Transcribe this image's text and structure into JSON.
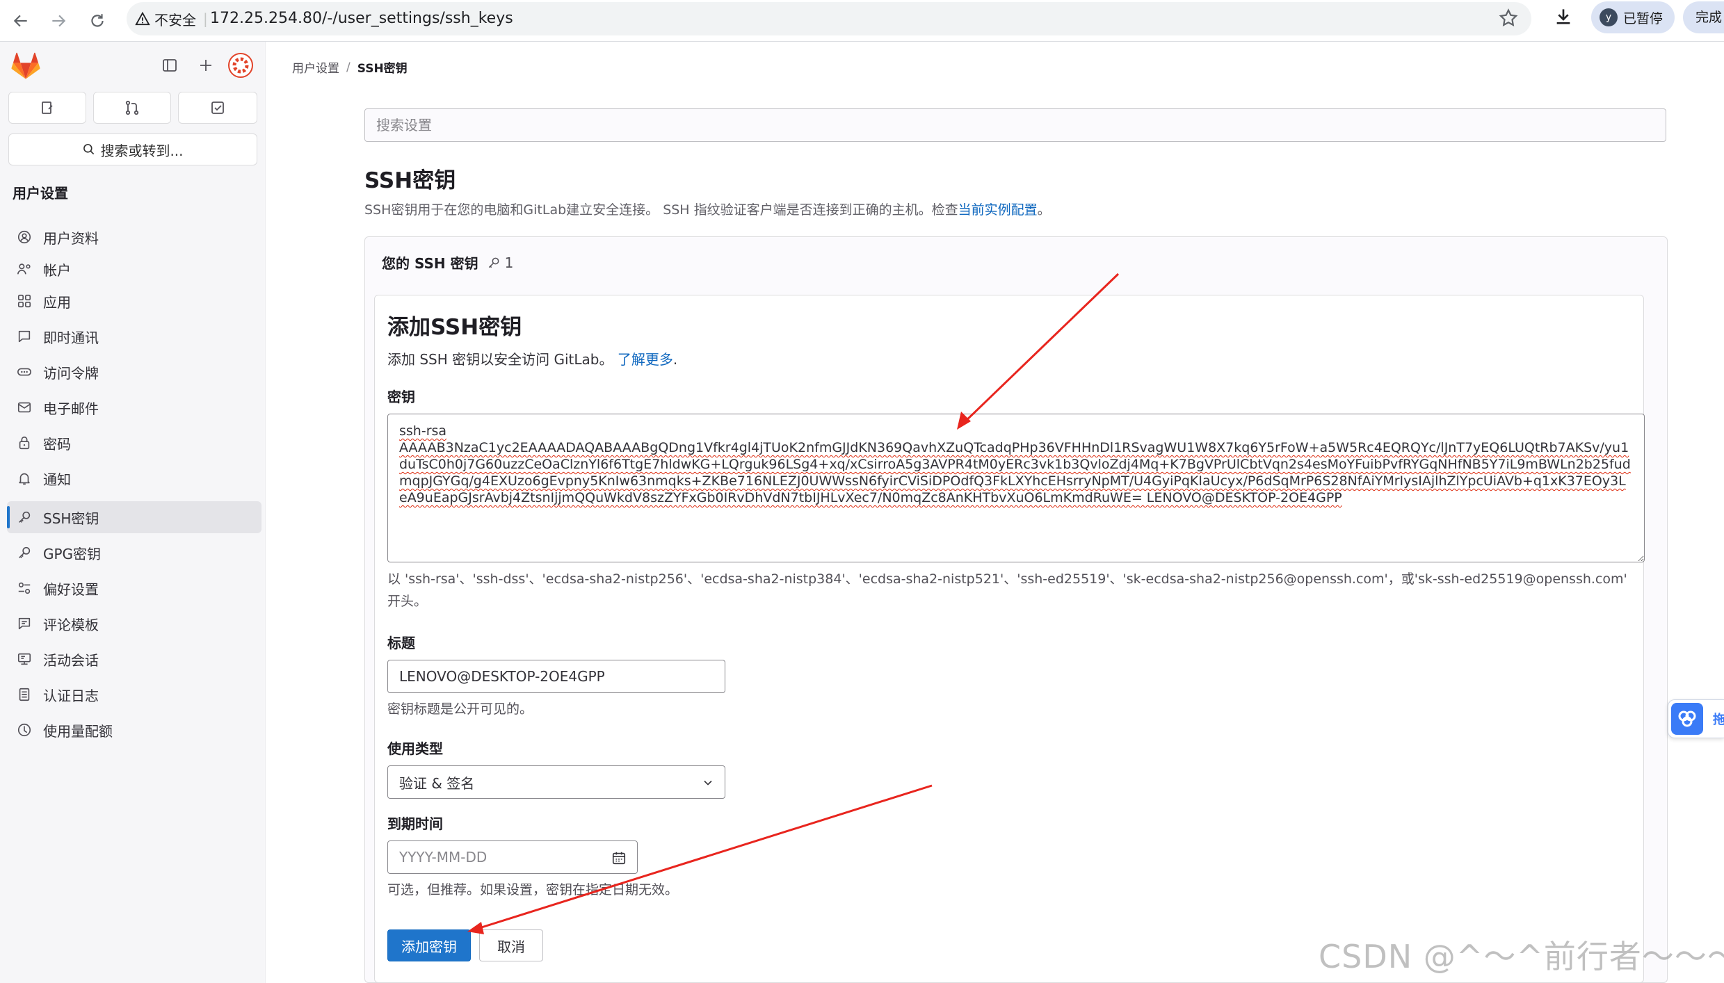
{
  "browser": {
    "security_label": "不安全",
    "url": "172.25.254.80/-/user_settings/ssh_keys",
    "profile_initial": "y",
    "profile_status": "已暂停",
    "finish_label": "完成"
  },
  "sidebar": {
    "search_label": "搜索或转到...",
    "section_title": "用户设置",
    "items": [
      {
        "label": "用户资料",
        "icon": "profile-icon"
      },
      {
        "label": "帐户",
        "icon": "account-icon"
      },
      {
        "label": "应用",
        "icon": "applications-icon"
      },
      {
        "label": "即时通讯",
        "icon": "chat-icon"
      },
      {
        "label": "访问令牌",
        "icon": "token-icon"
      },
      {
        "label": "电子邮件",
        "icon": "mail-icon"
      },
      {
        "label": "密码",
        "icon": "lock-icon"
      },
      {
        "label": "通知",
        "icon": "bell-icon"
      },
      {
        "label": "SSH密钥",
        "icon": "key-icon",
        "active": true
      },
      {
        "label": "GPG密钥",
        "icon": "key-icon"
      },
      {
        "label": "偏好设置",
        "icon": "preferences-icon"
      },
      {
        "label": "评论模板",
        "icon": "comment-icon"
      },
      {
        "label": "活动会话",
        "icon": "monitor-icon"
      },
      {
        "label": "认证日志",
        "icon": "log-icon"
      },
      {
        "label": "使用量配额",
        "icon": "quota-icon"
      }
    ]
  },
  "breadcrumb": {
    "parent": "用户设置",
    "separator": "/",
    "current": "SSH密钥"
  },
  "search": {
    "placeholder": "搜索设置"
  },
  "page": {
    "title": "SSH密钥",
    "description": "SSH密钥用于在您的电脑和GitLab建立安全连接。 SSH 指纹验证客户端是否连接到正确的主机。检查",
    "description_link": "当前实例配置",
    "description_end": "。"
  },
  "keys_card": {
    "title": "您的 SSH 密钥",
    "count": "1"
  },
  "add_form": {
    "title": "添加SSH密钥",
    "description": "添加 SSH 密钥以安全访问 GitLab。",
    "learn_more": "了解更多",
    "learn_more_end": ".",
    "key_label": "密钥",
    "key_value": "ssh-rsa\nAAAAB3NzaC1yc2EAAAADAQABAAABgQDng1Vfkr4gl4jTUoK2nfmGJJdKN369QavhXZuQTcadqPHp36VFHHnDl1RSvagWU1W8X7kq6Y5rFoW+a5W5Rc4EQRQYc/lJnT7yEQ6LUQtRb7AKSv/yu1duTsC0h0j7G60uzzCeOaClznYl6f6TtgE7hldwKG+LQrguk96LSg4+xq/xCsirroA5g3AVPR4tM0yERc3vk1b3QvloZdj4Mq+K7BgVPrUlCbtVqn2s4esMoYFuibPvfRYGqNHfNB5Y7iL9mBWLn2b25fudmqpJGYGq/g4EXUzo6gEvpny5KnIw63nmqks+ZKBe716NLEZJ0UWWssN6fyirCViSiDPOdfQ3FkLXYhcEHsrryNpMT/U4GyiPqKIaUcyx/P6dSqMrP6S28NfAiYMrIysIAjlhZlYpcUiAVb+q1xK37EOy3LeA9uEapGJsrAvbj4ZtsnIjjmQQuWkdV8szZYFxGb0IRvDhVdN7tbIJHLvXec7/N0mqZc8AnKHTbvXuO6LmKmdRuWE= LENOVO@DESKTOP-2OE4GPP",
    "key_help": "以 'ssh-rsa'、'ssh-dss'、'ecdsa-sha2-nistp256'、'ecdsa-sha2-nistp384'、'ecdsa-sha2-nistp521'、'ssh-ed25519'、'sk-ecdsa-sha2-nistp256@openssh.com'，或'sk-ssh-ed25519@openssh.com' 开头。",
    "title_label": "标题",
    "title_value": "LENOVO@DESKTOP-2OE4GPP",
    "title_help": "密钥标题是公开可见的。",
    "usage_label": "使用类型",
    "usage_value": "验证 & 签名",
    "expiry_label": "到期时间",
    "expiry_placeholder": "YYYY-MM-DD",
    "expiry_help": "可选，但推荐。如果设置，密钥在指定日期无效。",
    "submit_label": "添加密钥",
    "cancel_label": "取消"
  },
  "side_widget": {
    "label": "拖"
  },
  "watermark": "CSDN @^～^前行者～～～",
  "colors": {
    "primary": "#1f75cb",
    "link": "#1068bf",
    "annotation_arrow": "#e8251e",
    "gitlab_orange": "#fc6d26"
  }
}
